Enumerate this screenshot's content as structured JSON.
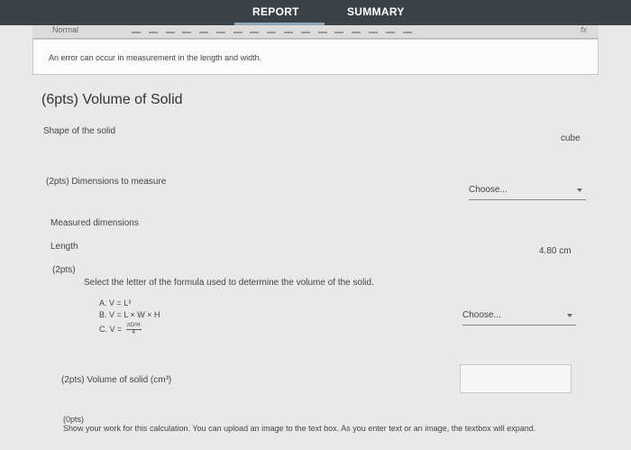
{
  "tabs": {
    "report": "REPORT",
    "summary": "SUMMARY"
  },
  "toolbar": {
    "style_label": "Normal",
    "fx_label": "fx"
  },
  "editor": {
    "text": "An error can occur in measurement in the length and width."
  },
  "section": {
    "title": "(6pts) Volume of Solid"
  },
  "shape": {
    "label": "Shape of the solid",
    "value": "cube"
  },
  "dimensions": {
    "label": "(2pts)  Dimensions to measure",
    "select_value": "Choose..."
  },
  "measured": {
    "label": "Measured dimensions"
  },
  "length": {
    "label": "Length",
    "value": "4.80 cm"
  },
  "formula": {
    "points": "(2pts)",
    "question": "Select the letter of the formula used to determine the volume of the solid.",
    "option_a": "A. V = L³",
    "option_b": "B. V = L × W × H",
    "option_c_prefix": "C. V =",
    "option_c_num": "πD²H",
    "option_c_den": "4",
    "select_value": "Choose..."
  },
  "volume": {
    "label": "(2pts)  Volume of solid (cm³)"
  },
  "work": {
    "points": "(0pts)",
    "text": "Show your work for this calculation. You can upload an image to the text box. As you enter text or an image, the textbox will expand."
  }
}
